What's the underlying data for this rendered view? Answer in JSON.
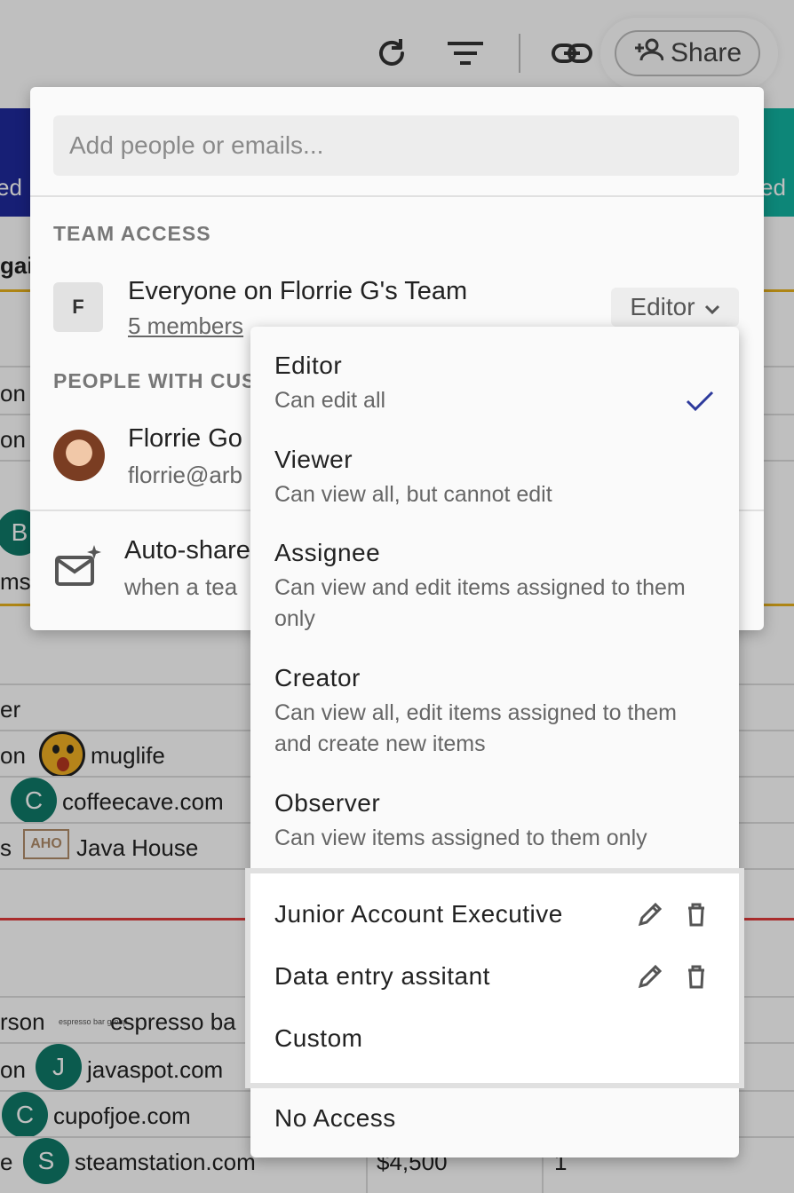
{
  "toolbar": {
    "icons": [
      "refresh-icon",
      "filter-icon",
      "link-icon"
    ],
    "share_label": "Share",
    "share_icon": "add-person-icon"
  },
  "background": {
    "band_left_text": "ed",
    "band_right_text": "ed",
    "row_fragments": [
      "gai",
      "on",
      "on",
      "ms",
      "er",
      "on",
      "s",
      "rson",
      "on",
      "e"
    ],
    "avatar_letters": [
      "B",
      "C",
      "J",
      "C",
      "S"
    ],
    "companies": [
      "muglife",
      "coffeecave.com",
      "Java House",
      "espresso ba",
      "javaspot.com",
      "cupofjoe.com",
      "steamstation.com"
    ],
    "logo_text_java_house": "AHO",
    "logo_text_espresso": "espresso bar group",
    "amount": "$4,500",
    "count": "1",
    "colors": {
      "band_left": "#1f2a9c",
      "band_right": "#12b3a0",
      "gold": "#e8b21c",
      "red": "#e23b3b",
      "avatar": "#0f7a68"
    }
  },
  "share_panel": {
    "add_placeholder": "Add people or emails...",
    "team_access_title": "TEAM ACCESS",
    "team": {
      "badge": "F",
      "name": "Everyone on Florrie G's Team",
      "members_link": "5 members",
      "role": "Editor"
    },
    "people_title": "PEOPLE WITH CUS",
    "person": {
      "name": "Florrie Go",
      "email": "florrie@arb"
    },
    "autoshare": {
      "title": "Auto-share",
      "subtitle": "when a tea"
    }
  },
  "role_dropdown": {
    "options": [
      {
        "title": "Editor",
        "desc": "Can edit all",
        "selected": true
      },
      {
        "title": "Viewer",
        "desc": "Can view all, but cannot edit"
      },
      {
        "title": "Assignee",
        "desc": "Can view and edit items assigned to them only"
      },
      {
        "title": "Creator",
        "desc": "Can view all, edit items assigned to them and create new items"
      },
      {
        "title": "Observer",
        "desc": "Can view items assigned to them only"
      }
    ],
    "custom_roles": [
      {
        "label": "Junior Account Executive"
      },
      {
        "label": "Data entry assitant"
      }
    ],
    "custom_label": "Custom",
    "no_access_label": "No Access"
  }
}
